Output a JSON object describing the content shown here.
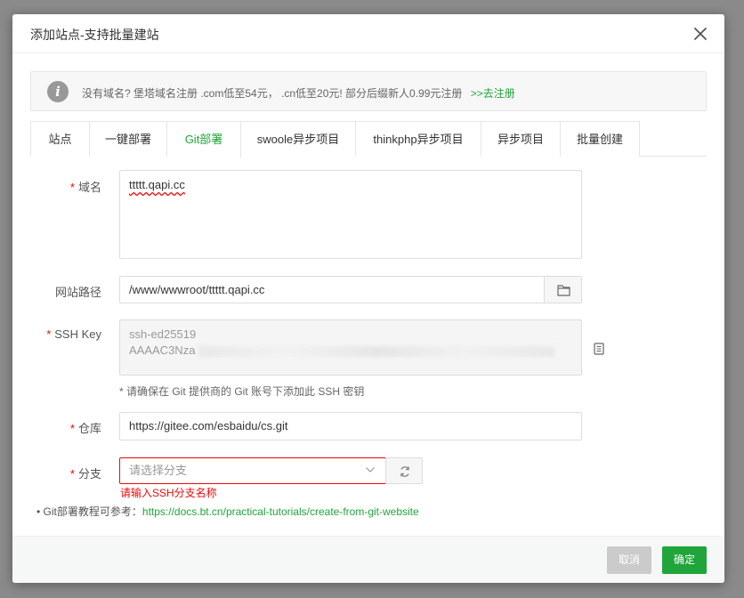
{
  "dialog": {
    "title": "添加站点-支持批量建站"
  },
  "notice": {
    "text": "没有域名? 堡塔域名注册 .com低至54元， .cn低至20元! 部分后缀新人0.99元注册",
    "link": ">>去注册"
  },
  "tabs": [
    {
      "label": "站点"
    },
    {
      "label": "一键部署"
    },
    {
      "label": "Git部署",
      "active": true
    },
    {
      "label": "swoole异步项目"
    },
    {
      "label": "thinkphp异步项目"
    },
    {
      "label": "异步项目"
    },
    {
      "label": "批量创建"
    }
  ],
  "form": {
    "domain": {
      "required_mark": "*",
      "label": "域名",
      "value": "ttttt.qapi.cc"
    },
    "path": {
      "label": "网站路径",
      "value": "/www/wwwroot/ttttt.qapi.cc"
    },
    "ssh_key": {
      "required_mark": "*",
      "label": "SSH Key",
      "line1": "ssh-ed25519",
      "line2": "AAAAC3Nza"
    },
    "hint": "* 请确保在 Git 提供商的 Git 账号下添加此 SSH 密钥",
    "repo": {
      "required_mark": "*",
      "label": "仓库",
      "value": "https://gitee.com/esbaidu/cs.git"
    },
    "branch": {
      "required_mark": "*",
      "label": "分支",
      "placeholder": "请选择分支",
      "error": "请输入SSH分支名称"
    }
  },
  "tutorial": {
    "prefix": "Git部署教程可参考：",
    "link": "https://docs.bt.cn/practical-tutorials/create-from-git-website"
  },
  "footer": {
    "cancel": "取消",
    "ok": "确定"
  },
  "colors": {
    "accent": "#20a53a",
    "error": "#ef0808",
    "cancel_bg": "#cbcbcb"
  },
  "icons": [
    "info-icon",
    "close-icon",
    "folder-icon",
    "copy-icon",
    "chevron-down-icon",
    "refresh-icon"
  ]
}
